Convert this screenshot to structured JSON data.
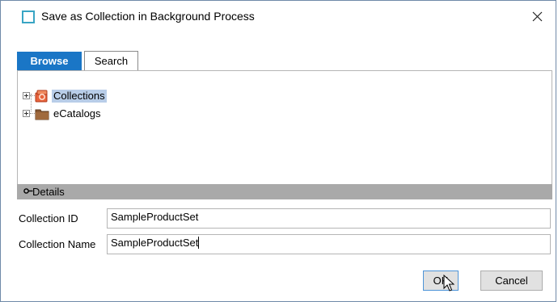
{
  "window": {
    "title": "Save as Collection in Background Process",
    "close_icon": "close-icon"
  },
  "tabs": [
    {
      "label": "Browse",
      "active": true
    },
    {
      "label": "Search",
      "active": false
    }
  ],
  "tree": {
    "items": [
      {
        "label": "Collections",
        "icon": "collections-icon",
        "selected": true
      },
      {
        "label": "eCatalogs",
        "icon": "folder-icon",
        "selected": false
      }
    ]
  },
  "details": {
    "label": "Details",
    "icon": "key-icon"
  },
  "form": {
    "collection_id": {
      "label": "Collection ID",
      "value": "SampleProductSet"
    },
    "collection_name": {
      "label": "Collection Name",
      "value": "SampleProductSet"
    }
  },
  "buttons": {
    "ok": "OK",
    "cancel": "Cancel"
  },
  "colors": {
    "accent": "#1a76c6",
    "selection": "#b8cde8",
    "details_bar": "#a9a9a9",
    "title_icon": "#39a5c4"
  }
}
